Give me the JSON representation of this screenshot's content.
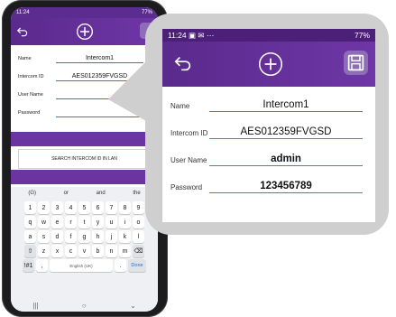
{
  "phone": {
    "status": {
      "time": "11:24",
      "right": "77%"
    },
    "form": [
      {
        "label": "Name",
        "value": "Intercom1"
      },
      {
        "label": "Intercom ID",
        "value": "AES012359FVGSD"
      },
      {
        "label": "User Name",
        "value": ""
      },
      {
        "label": "Password",
        "value": ""
      }
    ],
    "search_button": "SEARCH INTERCOM ID IN LAN",
    "keyboard": {
      "suggestions": [
        "(G)",
        "or",
        "and",
        "the"
      ],
      "row_numbers": [
        "1",
        "2",
        "3",
        "4",
        "5",
        "6",
        "7",
        "8",
        "9"
      ],
      "row1": [
        "q",
        "w",
        "e",
        "r",
        "t",
        "y",
        "u",
        "i",
        "o"
      ],
      "row2": [
        "a",
        "s",
        "d",
        "f",
        "g",
        "h",
        "j",
        "k",
        "l"
      ],
      "row3": [
        "z",
        "x",
        "c",
        "v",
        "b",
        "n",
        "m"
      ],
      "symbols_key": "!#1",
      "space_label": "English (UK)",
      "done_key": "Done",
      "nav": [
        "|||",
        "○",
        "⌄"
      ]
    }
  },
  "zoom": {
    "status": {
      "time": "11:24",
      "left_icons": "▣ ✉ ⋯",
      "right": "77%"
    },
    "form": [
      {
        "label": "Name",
        "value": "Intercom1"
      },
      {
        "label": "Intercom ID",
        "value": "AES012359FVGSD"
      },
      {
        "label": "User Name",
        "value": "admin"
      },
      {
        "label": "Password",
        "value": "123456789"
      }
    ]
  },
  "icons": {
    "back": "back-arrow-icon",
    "add": "add-circle-icon",
    "save": "floppy-disk-icon"
  },
  "colors": {
    "brand_purple": "#5a2a8c",
    "underline": "#3a86c0",
    "callout_gray": "#cfcfcf"
  }
}
